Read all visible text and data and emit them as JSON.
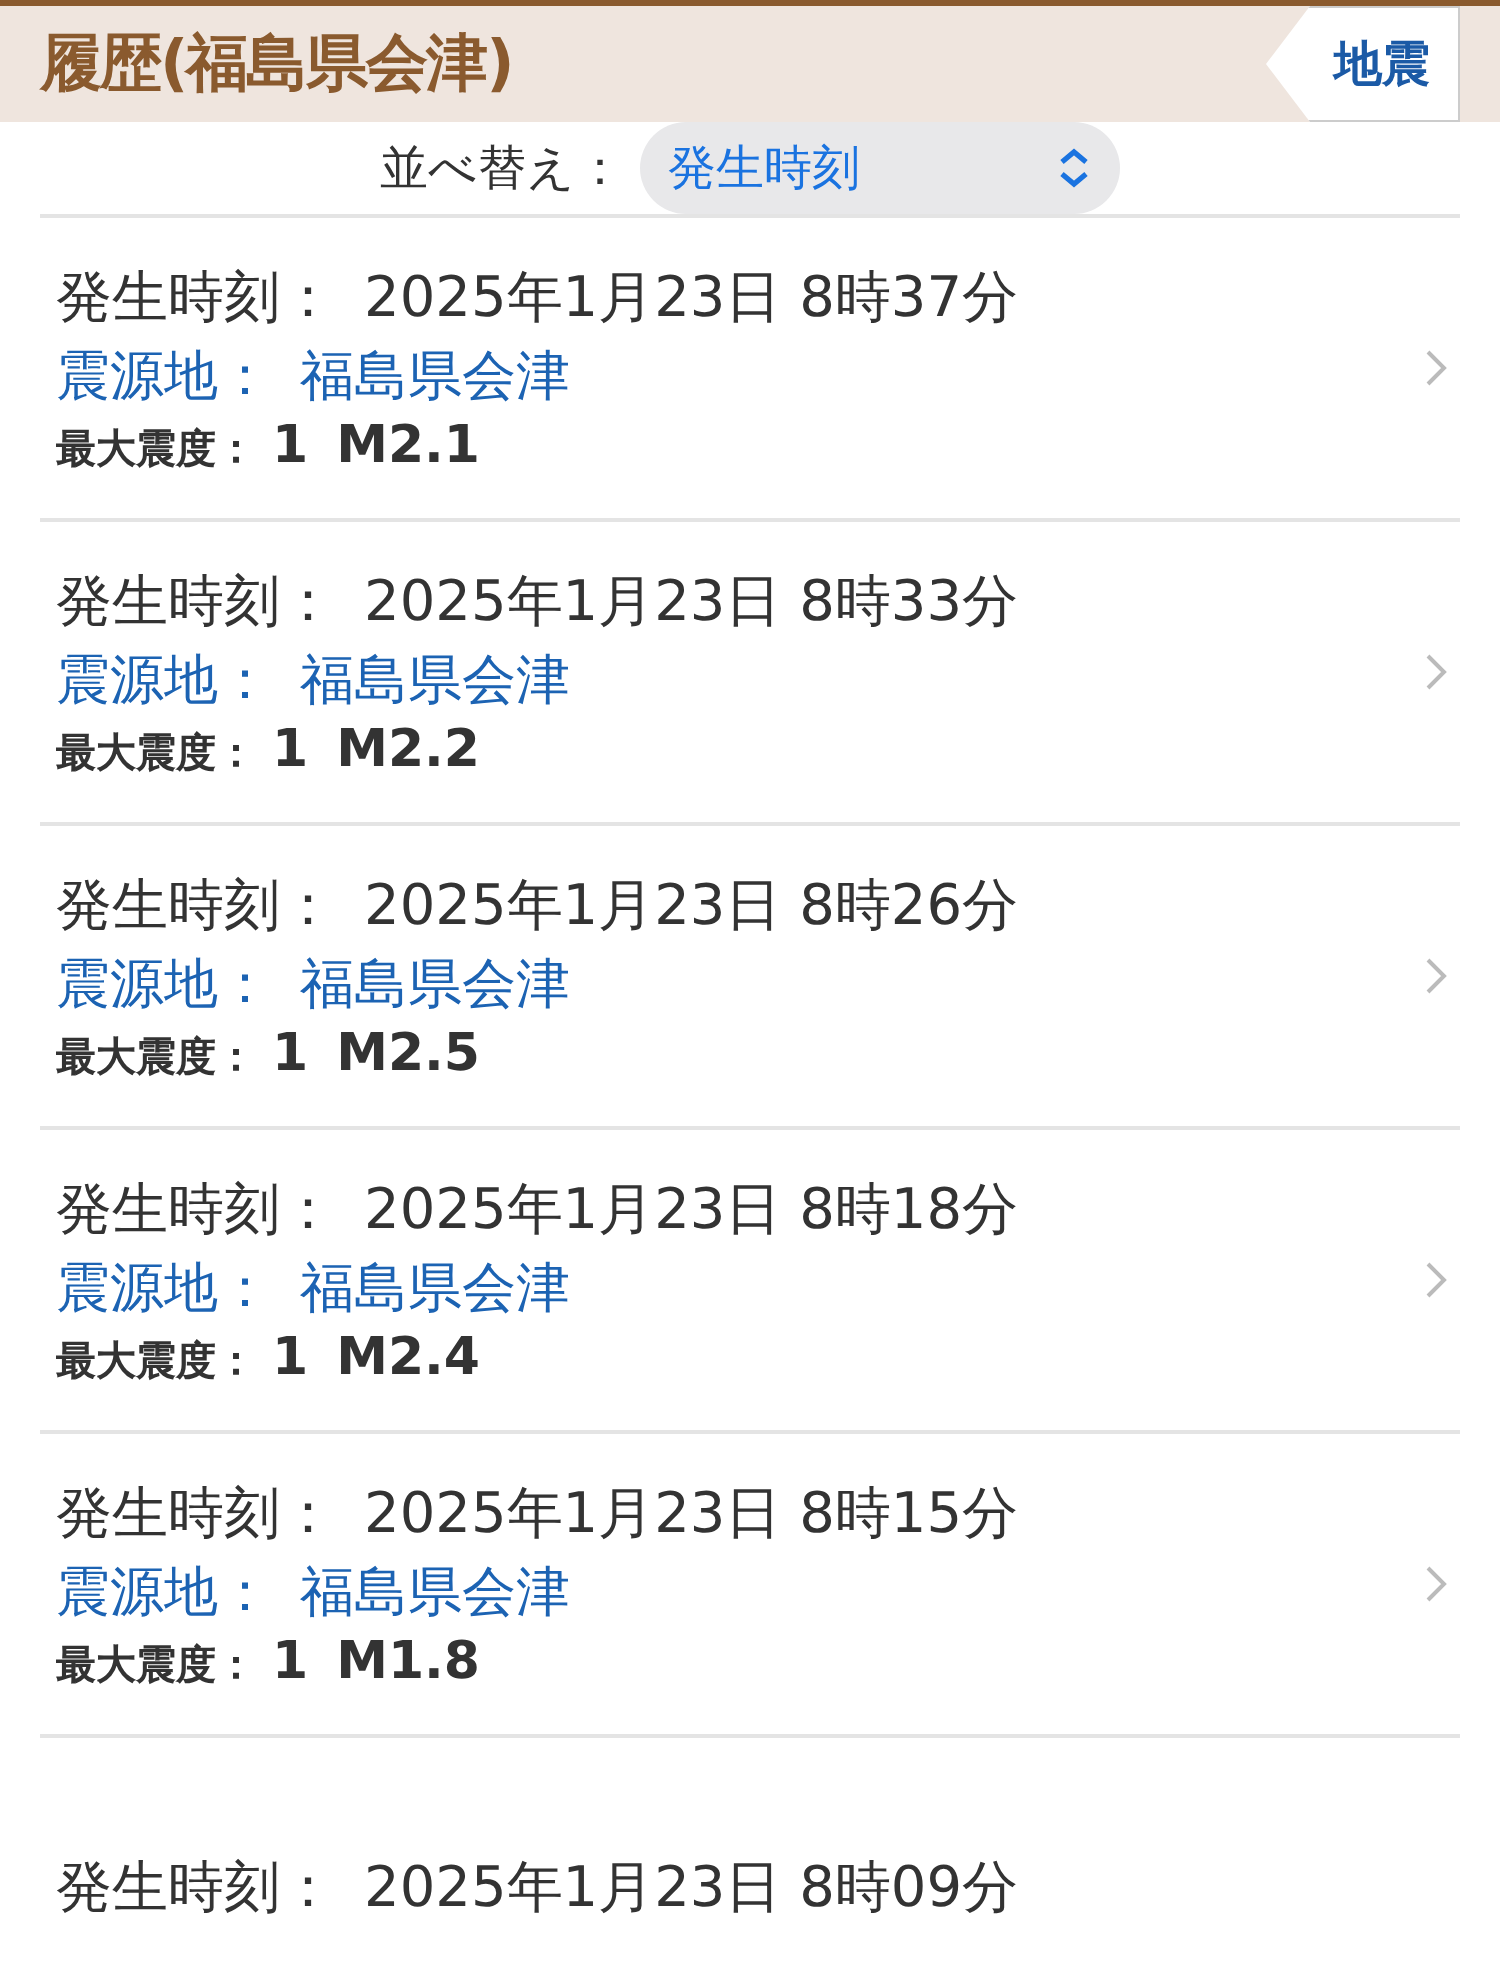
{
  "header": {
    "title": "履歴(福島県会津)",
    "back_button": "地震"
  },
  "sort": {
    "label": "並べ替え：",
    "value": "発生時刻"
  },
  "events": [
    {
      "time_label": "発生時刻：",
      "time": "2025年1月23日 8時37分",
      "epicenter_label": "震源地：",
      "epicenter": "福島県会津",
      "intensity_label": "最大震度：",
      "intensity": "1",
      "magnitude": "M2.1"
    },
    {
      "time_label": "発生時刻：",
      "time": "2025年1月23日 8時33分",
      "epicenter_label": "震源地：",
      "epicenter": "福島県会津",
      "intensity_label": "最大震度：",
      "intensity": "1",
      "magnitude": "M2.2"
    },
    {
      "time_label": "発生時刻：",
      "time": "2025年1月23日 8時26分",
      "epicenter_label": "震源地：",
      "epicenter": "福島県会津",
      "intensity_label": "最大震度：",
      "intensity": "1",
      "magnitude": "M2.5"
    },
    {
      "time_label": "発生時刻：",
      "time": "2025年1月23日 8時18分",
      "epicenter_label": "震源地：",
      "epicenter": "福島県会津",
      "intensity_label": "最大震度：",
      "intensity": "1",
      "magnitude": "M2.4"
    },
    {
      "time_label": "発生時刻：",
      "time": "2025年1月23日 8時15分",
      "epicenter_label": "震源地：",
      "epicenter": "福島県会津",
      "intensity_label": "最大震度：",
      "intensity": "1",
      "magnitude": "M1.8"
    },
    {
      "time_label": "発生時刻：",
      "time": "2025年1月23日 8時09分"
    }
  ]
}
